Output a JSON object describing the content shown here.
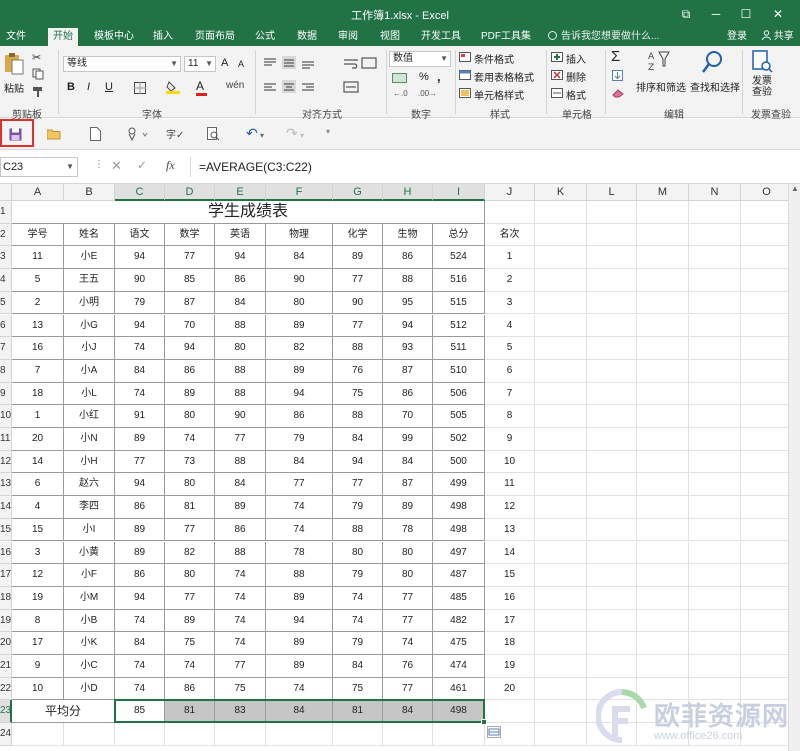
{
  "window": {
    "title": "工作簿1.xlsx - Excel",
    "controls": [
      "⧉",
      "─",
      "☐",
      "✕"
    ]
  },
  "ribbon_tabs": [
    "文件",
    "开始",
    "模板中心",
    "插入",
    "页面布局",
    "公式",
    "数据",
    "审阅",
    "视图",
    "开发工具",
    "PDF工具集"
  ],
  "active_tab": "开始",
  "tell_me": "告诉我您想要做什么...",
  "login": "登录",
  "share": "共享",
  "ribbon": {
    "clipboard": {
      "paste": "粘贴",
      "label": "剪贴板"
    },
    "font": {
      "name": "等线",
      "size": "11",
      "grow": "A",
      "shrink": "A",
      "bold": "B",
      "italic": "I",
      "underline": "U",
      "wen": "wén",
      "label": "字体"
    },
    "alignment": {
      "label": "对齐方式"
    },
    "number": {
      "format": "数值",
      "percent": "%",
      "comma": ",",
      "label": "数字"
    },
    "styles": {
      "cond": "条件格式",
      "table": "套用表格格式",
      "cell": "单元格样式",
      "label": "样式"
    },
    "cells": {
      "insert": "插入",
      "delete": "删除",
      "format": "格式",
      "label": "单元格"
    },
    "editing": {
      "sort": "排序和筛选",
      "find": "查找和选择",
      "label": "编辑"
    },
    "invoice": {
      "check": "发票查验",
      "label": "发票查验"
    }
  },
  "colors": {
    "excel_green": "#217346",
    "selection_gray": "#c6c6c6",
    "highlight_red": "#e03030"
  },
  "name_box": "C23",
  "formula": "=AVERAGE(C3:C22)",
  "fx": "fx",
  "columns": [
    "A",
    "B",
    "C",
    "D",
    "E",
    "F",
    "G",
    "H",
    "I",
    "J",
    "K",
    "L",
    "M",
    "N",
    "O"
  ],
  "rows": [
    "1",
    "2",
    "3",
    "4",
    "5",
    "6",
    "7",
    "8",
    "9",
    "10",
    "11",
    "12",
    "13",
    "14",
    "15",
    "16",
    "17",
    "18",
    "19",
    "20",
    "21",
    "22",
    "23",
    "24"
  ],
  "sheet": {
    "title": "学生成绩表",
    "headers": [
      "学号",
      "姓名",
      "语文",
      "数学",
      "英语",
      "物理",
      "化学",
      "生物",
      "总分",
      "名次"
    ],
    "data": [
      [
        "11",
        "小E",
        "94",
        "77",
        "94",
        "84",
        "89",
        "86",
        "524",
        "1"
      ],
      [
        "5",
        "王五",
        "90",
        "85",
        "86",
        "90",
        "77",
        "88",
        "516",
        "2"
      ],
      [
        "2",
        "小明",
        "79",
        "87",
        "84",
        "80",
        "90",
        "95",
        "515",
        "3"
      ],
      [
        "13",
        "小G",
        "94",
        "70",
        "88",
        "89",
        "77",
        "94",
        "512",
        "4"
      ],
      [
        "16",
        "小J",
        "74",
        "94",
        "80",
        "82",
        "88",
        "93",
        "511",
        "5"
      ],
      [
        "7",
        "小A",
        "84",
        "86",
        "88",
        "89",
        "76",
        "87",
        "510",
        "6"
      ],
      [
        "18",
        "小L",
        "74",
        "89",
        "88",
        "94",
        "75",
        "86",
        "506",
        "7"
      ],
      [
        "1",
        "小红",
        "91",
        "80",
        "90",
        "86",
        "88",
        "70",
        "505",
        "8"
      ],
      [
        "20",
        "小N",
        "89",
        "74",
        "77",
        "79",
        "84",
        "99",
        "502",
        "9"
      ],
      [
        "14",
        "小H",
        "77",
        "73",
        "88",
        "84",
        "94",
        "84",
        "500",
        "10"
      ],
      [
        "6",
        "赵六",
        "94",
        "80",
        "84",
        "77",
        "77",
        "87",
        "499",
        "11"
      ],
      [
        "4",
        "李四",
        "86",
        "81",
        "89",
        "74",
        "79",
        "89",
        "498",
        "12"
      ],
      [
        "15",
        "小I",
        "89",
        "77",
        "86",
        "74",
        "88",
        "78",
        "498",
        "13"
      ],
      [
        "3",
        "小黄",
        "89",
        "82",
        "88",
        "78",
        "80",
        "80",
        "497",
        "14"
      ],
      [
        "12",
        "小F",
        "86",
        "80",
        "74",
        "88",
        "79",
        "80",
        "487",
        "15"
      ],
      [
        "19",
        "小M",
        "94",
        "77",
        "74",
        "89",
        "74",
        "77",
        "485",
        "16"
      ],
      [
        "8",
        "小B",
        "74",
        "89",
        "74",
        "94",
        "74",
        "77",
        "482",
        "17"
      ],
      [
        "17",
        "小K",
        "84",
        "75",
        "74",
        "89",
        "79",
        "74",
        "475",
        "18"
      ],
      [
        "9",
        "小C",
        "74",
        "74",
        "77",
        "89",
        "84",
        "76",
        "474",
        "19"
      ],
      [
        "10",
        "小D",
        "74",
        "86",
        "75",
        "74",
        "75",
        "77",
        "461",
        "20"
      ]
    ],
    "avg_label": "平均分",
    "averages": [
      "85",
      "81",
      "83",
      "84",
      "81",
      "84",
      "498"
    ]
  },
  "watermark": {
    "text": "欧菲资源网",
    "url": "www.office26.com"
  }
}
